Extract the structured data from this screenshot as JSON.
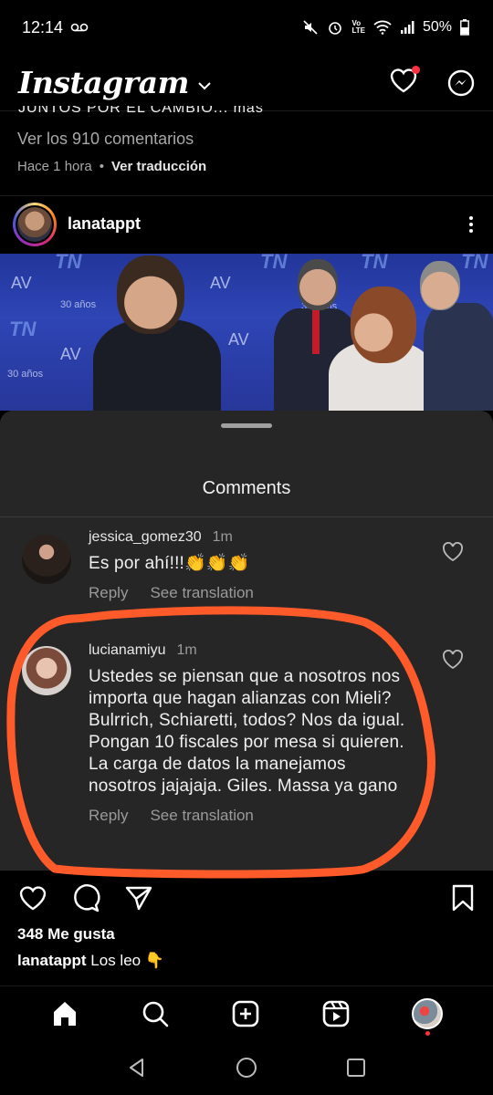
{
  "status_bar": {
    "time": "12:14",
    "volte": "Vo\nLTE",
    "battery": "50%"
  },
  "header": {
    "app_title": "Instagram"
  },
  "previous_post": {
    "cut_caption": "JUNTOS POR EL CAMBIO... más",
    "view_comments": "Ver los 910 comentarios",
    "time_ago": "Hace 1 hora",
    "separator": "•",
    "translate": "Ver traducción"
  },
  "post": {
    "username": "lanatappt",
    "image_logos": [
      "TN",
      "AV",
      "30 años"
    ]
  },
  "comments_sheet": {
    "title": "Comments",
    "comments": [
      {
        "username": "jessica_gomez30",
        "time": "1m",
        "text": "Es por ahí!!!👏👏👏",
        "reply": "Reply",
        "see_translation": "See translation"
      },
      {
        "username": "lucianamiyu",
        "time": "1m",
        "text": "Ustedes se piensan que a nosotros nos importa que hagan alianzas con Mieli? Bulrrich, Schiaretti, todos? Nos da igual. Pongan 10 fiscales por mesa si quieren. La carga de datos la manejamos nosotros jajajaja. Giles. Massa ya gano",
        "reply": "Reply",
        "see_translation": "See translation"
      }
    ],
    "annotation_color": "#ff5a2a"
  },
  "post_footer": {
    "likes": "348 Me gusta",
    "caption_user": "lanatappt",
    "caption_text": "Los leo 👇"
  },
  "colors": {
    "background": "#000000",
    "sheet": "#262626",
    "muted_text": "#a8a8a8",
    "notification": "#ff3040"
  }
}
